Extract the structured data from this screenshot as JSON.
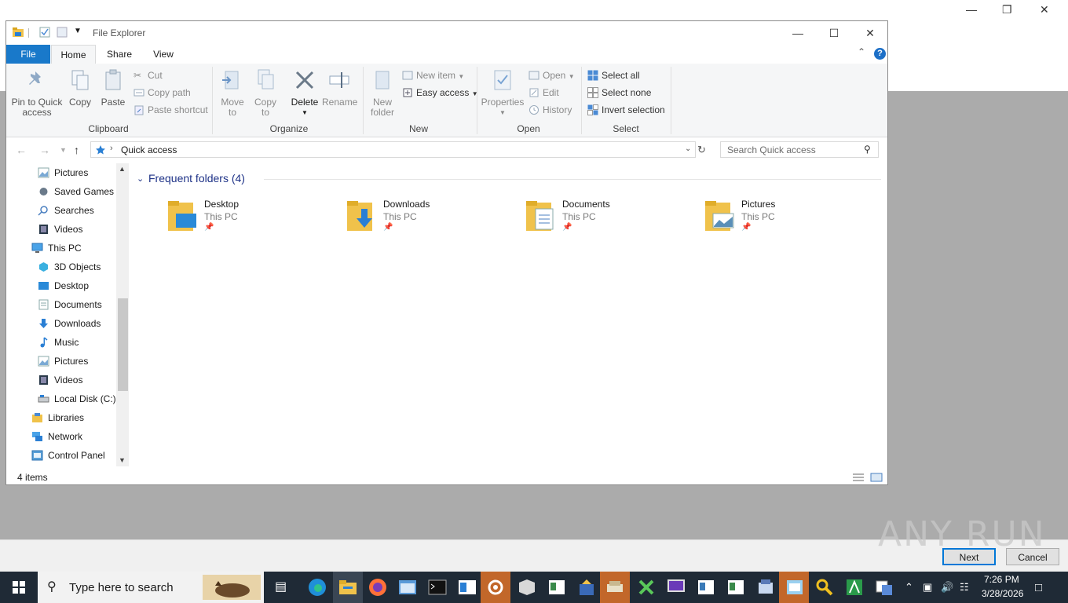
{
  "explorer": {
    "title": "File Explorer",
    "tabs": [
      "File",
      "Home",
      "Share",
      "View"
    ],
    "ribbon": {
      "clipboard": {
        "label": "Clipboard",
        "pin_label_1": "Pin to Quick",
        "pin_label_2": "access",
        "copy": "Copy",
        "paste": "Paste",
        "cut": "Cut",
        "copy_path": "Copy path",
        "paste_shortcut": "Paste shortcut"
      },
      "organize": {
        "label": "Organize",
        "move_1": "Move",
        "move_2": "to",
        "copy_1": "Copy",
        "copy_2": "to",
        "delete": "Delete",
        "rename": "Rename"
      },
      "new": {
        "label": "New",
        "new_folder_1": "New",
        "new_folder_2": "folder",
        "new_item": "New item",
        "easy_access": "Easy access"
      },
      "open": {
        "label": "Open",
        "properties": "Properties",
        "open": "Open",
        "edit": "Edit",
        "history": "History"
      },
      "select": {
        "label": "Select",
        "select_all": "Select all",
        "select_none": "Select none",
        "invert": "Invert selection"
      }
    },
    "address": "Quick access",
    "search_placeholder": "Search Quick access",
    "nav_items": [
      "Pictures",
      "Saved Games",
      "Searches",
      "Videos",
      "This PC",
      "3D Objects",
      "Desktop",
      "Documents",
      "Downloads",
      "Music",
      "Pictures",
      "Videos",
      "Local Disk (C:)",
      "Libraries",
      "Network",
      "Control Panel"
    ],
    "frequent_header": "Frequent folders (4)",
    "folders": [
      {
        "name": "Desktop",
        "location": "This PC"
      },
      {
        "name": "Downloads",
        "location": "This PC"
      },
      {
        "name": "Documents",
        "location": "This PC"
      },
      {
        "name": "Pictures",
        "location": "This PC"
      }
    ],
    "status": "4 items"
  },
  "wizard": {
    "next": "Next",
    "cancel": "Cancel"
  },
  "watermark": "ANY RUN",
  "taskbar": {
    "search_placeholder": "Type here to search",
    "time": "7:26 PM",
    "date": "3/28/2026"
  },
  "colors": {
    "accent": "#1979ca",
    "taskbar": "#1f2a36",
    "folder": "#f0c24b"
  }
}
